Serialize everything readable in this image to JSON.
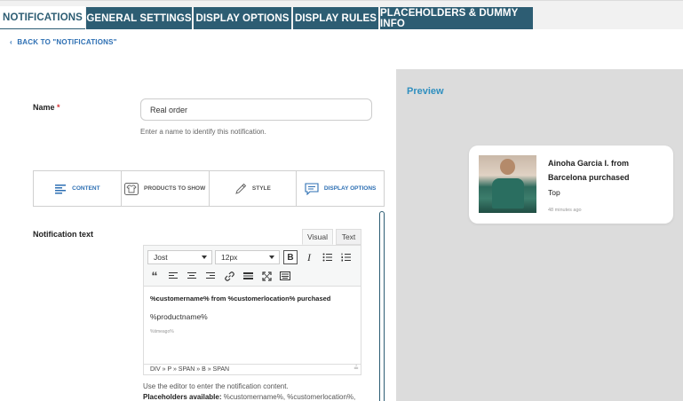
{
  "tabs": [
    {
      "label": "NOTIFICATIONS",
      "active": true
    },
    {
      "label": "GENERAL SETTINGS",
      "active": false
    },
    {
      "label": "DISPLAY OPTIONS",
      "active": false
    },
    {
      "label": "DISPLAY RULES",
      "active": false
    },
    {
      "label": "PLACEHOLDERS & DUMMY INFO",
      "active": false
    }
  ],
  "back_link": "BACK TO \"NOTIFICATIONS\"",
  "form": {
    "name_label": "Name",
    "required_mark": "*",
    "name_value": "Real order",
    "name_help": "Enter a name to identify this notification."
  },
  "section_tabs": [
    {
      "label": "CONTENT",
      "icon": "align-left-icon"
    },
    {
      "label": "PRODUCTS TO SHOW",
      "icon": "shirt-icon"
    },
    {
      "label": "STYLE",
      "icon": "pipette-icon"
    },
    {
      "label": "DISPLAY OPTIONS",
      "icon": "chat-bubble-icon"
    }
  ],
  "notification_text": {
    "label": "Notification text",
    "mode_visual": "Visual",
    "mode_text": "Text",
    "font_family": "Jost",
    "font_size": "12px",
    "line1": "%customername% from %customerlocation% purchased",
    "line2": "%productname%",
    "line3": "%timeago%",
    "path": "DIV » P » SPAN » B » SPAN",
    "help": "Use the editor to enter the notification content.",
    "placeholders_label": "Placeholders available:",
    "placeholders_value": " %customername%, %customerlocation%,"
  },
  "preview": {
    "title": "Preview",
    "card_title": "Ainoha Garcia I. from Barcelona purchased",
    "card_product": "Top",
    "card_time": "48 minutes ago"
  },
  "colors": {
    "tab_bg": "#2d5d73",
    "link": "#2d6fb3",
    "preview_title": "#2f8fbf",
    "required": "#d63638"
  }
}
